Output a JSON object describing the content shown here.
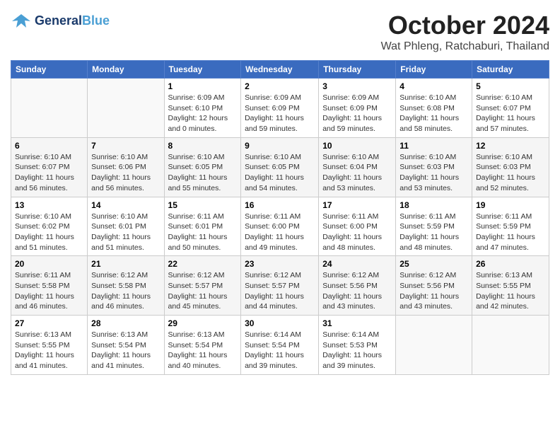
{
  "logo": {
    "line1": "General",
    "line2": "Blue"
  },
  "title": "October 2024",
  "subtitle": "Wat Phleng, Ratchaburi, Thailand",
  "days_header": [
    "Sunday",
    "Monday",
    "Tuesday",
    "Wednesday",
    "Thursday",
    "Friday",
    "Saturday"
  ],
  "weeks": [
    [
      {
        "day": "",
        "info": ""
      },
      {
        "day": "",
        "info": ""
      },
      {
        "day": "1",
        "info": "Sunrise: 6:09 AM\nSunset: 6:10 PM\nDaylight: 12 hours\nand 0 minutes."
      },
      {
        "day": "2",
        "info": "Sunrise: 6:09 AM\nSunset: 6:09 PM\nDaylight: 11 hours\nand 59 minutes."
      },
      {
        "day": "3",
        "info": "Sunrise: 6:09 AM\nSunset: 6:09 PM\nDaylight: 11 hours\nand 59 minutes."
      },
      {
        "day": "4",
        "info": "Sunrise: 6:10 AM\nSunset: 6:08 PM\nDaylight: 11 hours\nand 58 minutes."
      },
      {
        "day": "5",
        "info": "Sunrise: 6:10 AM\nSunset: 6:07 PM\nDaylight: 11 hours\nand 57 minutes."
      }
    ],
    [
      {
        "day": "6",
        "info": "Sunrise: 6:10 AM\nSunset: 6:07 PM\nDaylight: 11 hours\nand 56 minutes."
      },
      {
        "day": "7",
        "info": "Sunrise: 6:10 AM\nSunset: 6:06 PM\nDaylight: 11 hours\nand 56 minutes."
      },
      {
        "day": "8",
        "info": "Sunrise: 6:10 AM\nSunset: 6:05 PM\nDaylight: 11 hours\nand 55 minutes."
      },
      {
        "day": "9",
        "info": "Sunrise: 6:10 AM\nSunset: 6:05 PM\nDaylight: 11 hours\nand 54 minutes."
      },
      {
        "day": "10",
        "info": "Sunrise: 6:10 AM\nSunset: 6:04 PM\nDaylight: 11 hours\nand 53 minutes."
      },
      {
        "day": "11",
        "info": "Sunrise: 6:10 AM\nSunset: 6:03 PM\nDaylight: 11 hours\nand 53 minutes."
      },
      {
        "day": "12",
        "info": "Sunrise: 6:10 AM\nSunset: 6:03 PM\nDaylight: 11 hours\nand 52 minutes."
      }
    ],
    [
      {
        "day": "13",
        "info": "Sunrise: 6:10 AM\nSunset: 6:02 PM\nDaylight: 11 hours\nand 51 minutes."
      },
      {
        "day": "14",
        "info": "Sunrise: 6:10 AM\nSunset: 6:01 PM\nDaylight: 11 hours\nand 51 minutes."
      },
      {
        "day": "15",
        "info": "Sunrise: 6:11 AM\nSunset: 6:01 PM\nDaylight: 11 hours\nand 50 minutes."
      },
      {
        "day": "16",
        "info": "Sunrise: 6:11 AM\nSunset: 6:00 PM\nDaylight: 11 hours\nand 49 minutes."
      },
      {
        "day": "17",
        "info": "Sunrise: 6:11 AM\nSunset: 6:00 PM\nDaylight: 11 hours\nand 48 minutes."
      },
      {
        "day": "18",
        "info": "Sunrise: 6:11 AM\nSunset: 5:59 PM\nDaylight: 11 hours\nand 48 minutes."
      },
      {
        "day": "19",
        "info": "Sunrise: 6:11 AM\nSunset: 5:59 PM\nDaylight: 11 hours\nand 47 minutes."
      }
    ],
    [
      {
        "day": "20",
        "info": "Sunrise: 6:11 AM\nSunset: 5:58 PM\nDaylight: 11 hours\nand 46 minutes."
      },
      {
        "day": "21",
        "info": "Sunrise: 6:12 AM\nSunset: 5:58 PM\nDaylight: 11 hours\nand 46 minutes."
      },
      {
        "day": "22",
        "info": "Sunrise: 6:12 AM\nSunset: 5:57 PM\nDaylight: 11 hours\nand 45 minutes."
      },
      {
        "day": "23",
        "info": "Sunrise: 6:12 AM\nSunset: 5:57 PM\nDaylight: 11 hours\nand 44 minutes."
      },
      {
        "day": "24",
        "info": "Sunrise: 6:12 AM\nSunset: 5:56 PM\nDaylight: 11 hours\nand 43 minutes."
      },
      {
        "day": "25",
        "info": "Sunrise: 6:12 AM\nSunset: 5:56 PM\nDaylight: 11 hours\nand 43 minutes."
      },
      {
        "day": "26",
        "info": "Sunrise: 6:13 AM\nSunset: 5:55 PM\nDaylight: 11 hours\nand 42 minutes."
      }
    ],
    [
      {
        "day": "27",
        "info": "Sunrise: 6:13 AM\nSunset: 5:55 PM\nDaylight: 11 hours\nand 41 minutes."
      },
      {
        "day": "28",
        "info": "Sunrise: 6:13 AM\nSunset: 5:54 PM\nDaylight: 11 hours\nand 41 minutes."
      },
      {
        "day": "29",
        "info": "Sunrise: 6:13 AM\nSunset: 5:54 PM\nDaylight: 11 hours\nand 40 minutes."
      },
      {
        "day": "30",
        "info": "Sunrise: 6:14 AM\nSunset: 5:54 PM\nDaylight: 11 hours\nand 39 minutes."
      },
      {
        "day": "31",
        "info": "Sunrise: 6:14 AM\nSunset: 5:53 PM\nDaylight: 11 hours\nand 39 minutes."
      },
      {
        "day": "",
        "info": ""
      },
      {
        "day": "",
        "info": ""
      }
    ]
  ]
}
